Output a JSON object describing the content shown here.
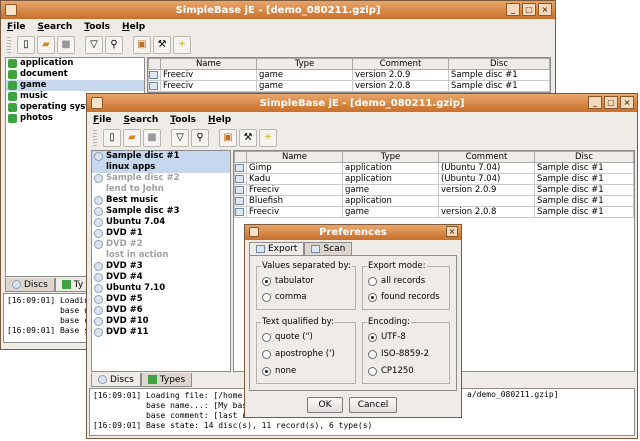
{
  "back_window": {
    "title": "SimpleBase jE - [demo_080211.gzip]",
    "menu": [
      "File",
      "Search",
      "Tools",
      "Help"
    ],
    "types": [
      "application",
      "document",
      "game",
      "music",
      "operating syste",
      "photos"
    ],
    "table_headers": [
      "Name",
      "Type",
      "Comment",
      "Disc"
    ],
    "rows": [
      [
        "Freeciv",
        "game",
        "version 2.0.9",
        "Sample disc #1"
      ],
      [
        "Freeciv",
        "game",
        "version 2.0.8",
        "Sample disc #1"
      ]
    ],
    "tabs": [
      "Discs",
      "Ty"
    ],
    "log": [
      "[16:09:01] Loadin",
      "           base n",
      "           base c",
      "[16:09:01] Base s"
    ]
  },
  "front_window": {
    "title": "SimpleBase jE - [demo_080211.gzip]",
    "menu": [
      "File",
      "Search",
      "Tools",
      "Help"
    ],
    "discs": [
      {
        "label": "Sample disc #1",
        "state": "selected"
      },
      {
        "label": "linux apps",
        "state": "selected-child"
      },
      {
        "label": "Sample disc #2",
        "state": "disabled"
      },
      {
        "label": "lend to John",
        "state": "disabled-child"
      },
      {
        "label": "Best music",
        "state": "normal"
      },
      {
        "label": "Sample disc #3",
        "state": "normal"
      },
      {
        "label": "Ubuntu 7.04",
        "state": "normal"
      },
      {
        "label": "DVD #1",
        "state": "normal"
      },
      {
        "label": "DVD #2",
        "state": "disabled"
      },
      {
        "label": "lost in action",
        "state": "disabled-child"
      },
      {
        "label": "DVD #3",
        "state": "normal"
      },
      {
        "label": "DVD #4",
        "state": "normal"
      },
      {
        "label": "Ubuntu 7.10",
        "state": "normal"
      },
      {
        "label": "DVD #5",
        "state": "normal"
      },
      {
        "label": "DVD #6",
        "state": "normal"
      },
      {
        "label": "DVD #10",
        "state": "normal"
      },
      {
        "label": "DVD #11",
        "state": "normal"
      }
    ],
    "table_headers": [
      "Name",
      "Type",
      "Comment",
      "Disc"
    ],
    "rows": [
      [
        "Gimp",
        "application",
        "(Ubuntu 7.04)",
        "Sample disc #1"
      ],
      [
        "Kadu",
        "application",
        "(Ubuntu 7.04)",
        "Sample disc #1"
      ],
      [
        "Freeciv",
        "game",
        "version 2.0.9",
        "Sample disc #1"
      ],
      [
        "Bluefish",
        "application",
        "",
        "Sample disc #1"
      ],
      [
        "Freeciv",
        "game",
        "version 2.0.8",
        "Sample disc #1"
      ]
    ],
    "tabs": [
      "Discs",
      "Types"
    ],
    "log": [
      "[16:09:01] Loading file: [/home,",
      "           base name...: [My bas",
      "           base comment: [last u",
      "[16:09:01] Base state: 14 disc(s), 11 record(s), 6 type(s)"
    ],
    "log_tail": "a/demo_080211.gzip]"
  },
  "dialog": {
    "title": "Preferences",
    "tabs": [
      "Export",
      "Scan"
    ],
    "groups": {
      "separator": {
        "title": "Values separated by:",
        "options": [
          "tabulator",
          "comma"
        ],
        "selected": 0
      },
      "export_mode": {
        "title": "Export mode:",
        "options": [
          "all records",
          "found records"
        ],
        "selected": 1
      },
      "qualifier": {
        "title": "Text qualified by:",
        "options": [
          "quote (\")",
          "apostrophe (')",
          "none"
        ],
        "selected": 2
      },
      "encoding": {
        "title": "Encoding:",
        "options": [
          "UTF-8",
          "ISO-8859-2",
          "CP1250"
        ],
        "selected": 0
      }
    },
    "ok_label": "OK",
    "cancel_label": "Cancel"
  }
}
